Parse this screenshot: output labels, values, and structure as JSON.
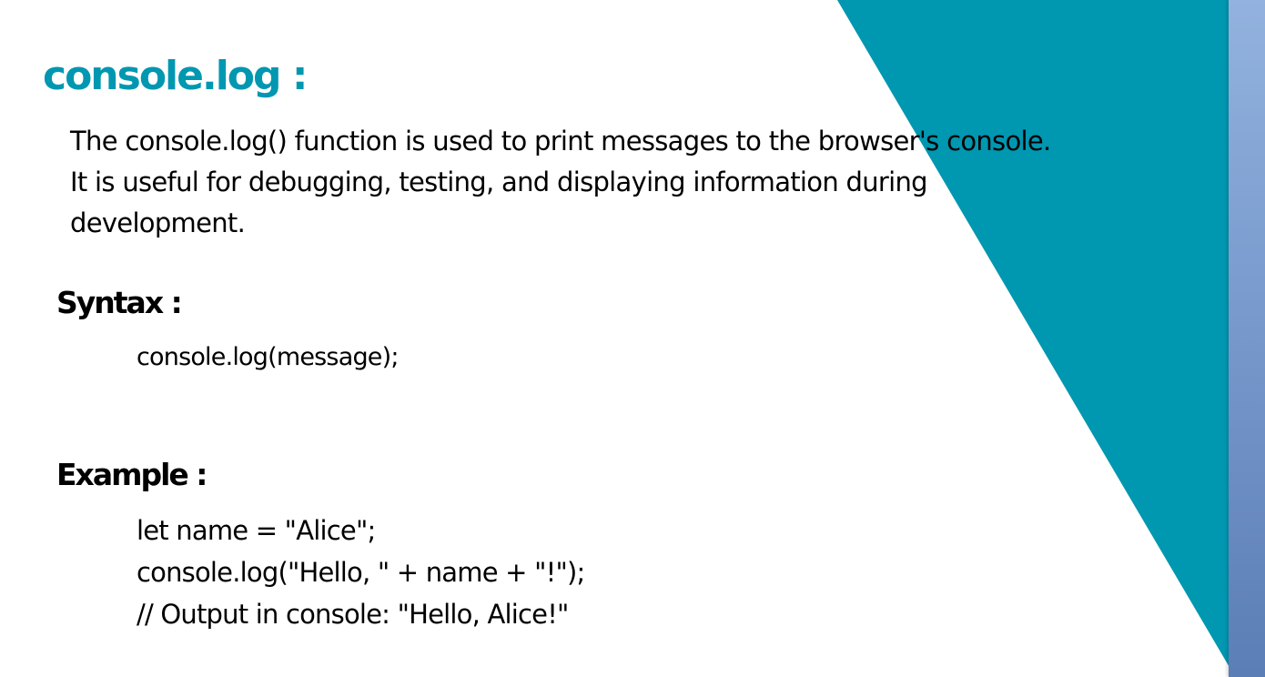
{
  "slide": {
    "title": "console.log :",
    "description_lines": [
      "The console.log() function is used to print messages to the browser's console.",
      "It is useful for debugging, testing, and displaying information during",
      "development."
    ],
    "syntax_heading": "Syntax :",
    "syntax_code": "console.log(message);",
    "example_heading": "Example :",
    "example_code_lines": [
      "let name = \"Alice\";",
      "console.log(\"Hello, \" + name + \"!\");",
      "// Output in console: \"Hello, Alice!\""
    ]
  },
  "colors": {
    "accent": "#0097b1",
    "text": "#000000",
    "background": "#ffffff",
    "side_strip": "#7b9dcf"
  }
}
